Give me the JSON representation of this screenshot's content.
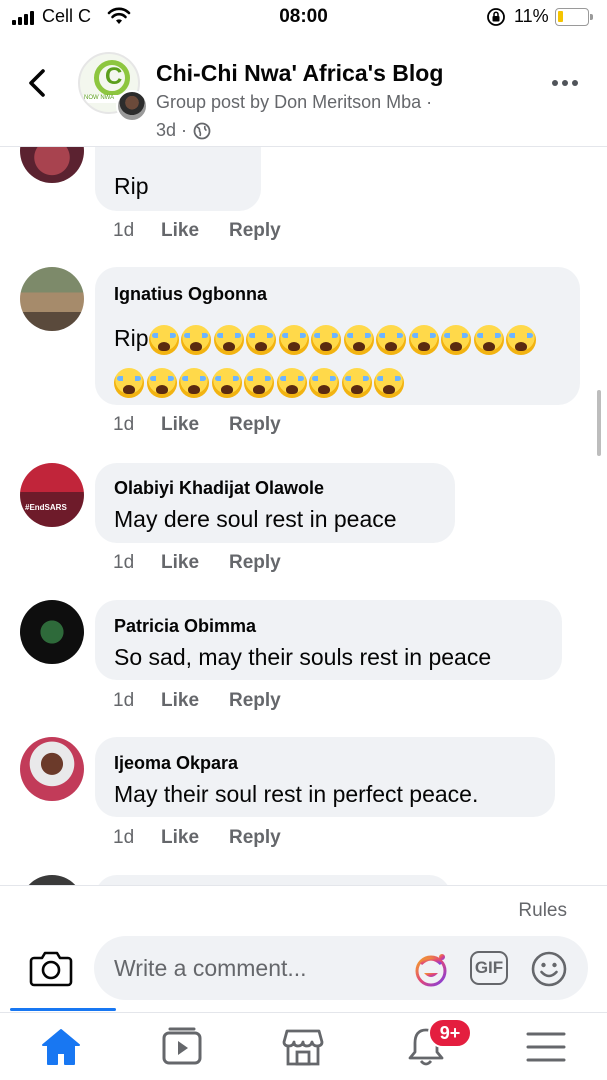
{
  "status_bar": {
    "carrier": "Cell C",
    "time": "08:00",
    "battery": "11%"
  },
  "header": {
    "title": "Chi-Chi Nwa' Africa's Blog",
    "subtitle": "Group post by Don Meritson Mba ·",
    "age": "3d ·",
    "group_logo_letter": "C",
    "group_logo_text": "NOW NWA"
  },
  "comments": {
    "partial_first": {
      "text": "Rip",
      "time": "1d"
    },
    "items": [
      {
        "name": "Ignatius Ogbonna",
        "text": "Rip",
        "emoji_count_line1": 12,
        "emoji_count_line2": 9,
        "emoji_name": "loudly-crying-face",
        "time": "1d"
      },
      {
        "name": "Olabiyi Khadijat Olawole",
        "text": "May dere soul rest in peace",
        "avatar_text": "#EndSARS",
        "time": "1d"
      },
      {
        "name": "Patricia Obimma",
        "text": "So sad, may their souls rest in peace",
        "time": "1d"
      },
      {
        "name": "Ijeoma Okpara",
        "text": "May their soul rest in perfect peace.",
        "time": "1d"
      }
    ],
    "like_label": "Like",
    "reply_label": "Reply"
  },
  "composer": {
    "rules_label": "Rules",
    "placeholder": "Write a comment...",
    "gif_label": "GIF"
  },
  "tabbar": {
    "notifications_badge": "9+",
    "active_tab": "home",
    "accent_color": "#1877f2"
  }
}
